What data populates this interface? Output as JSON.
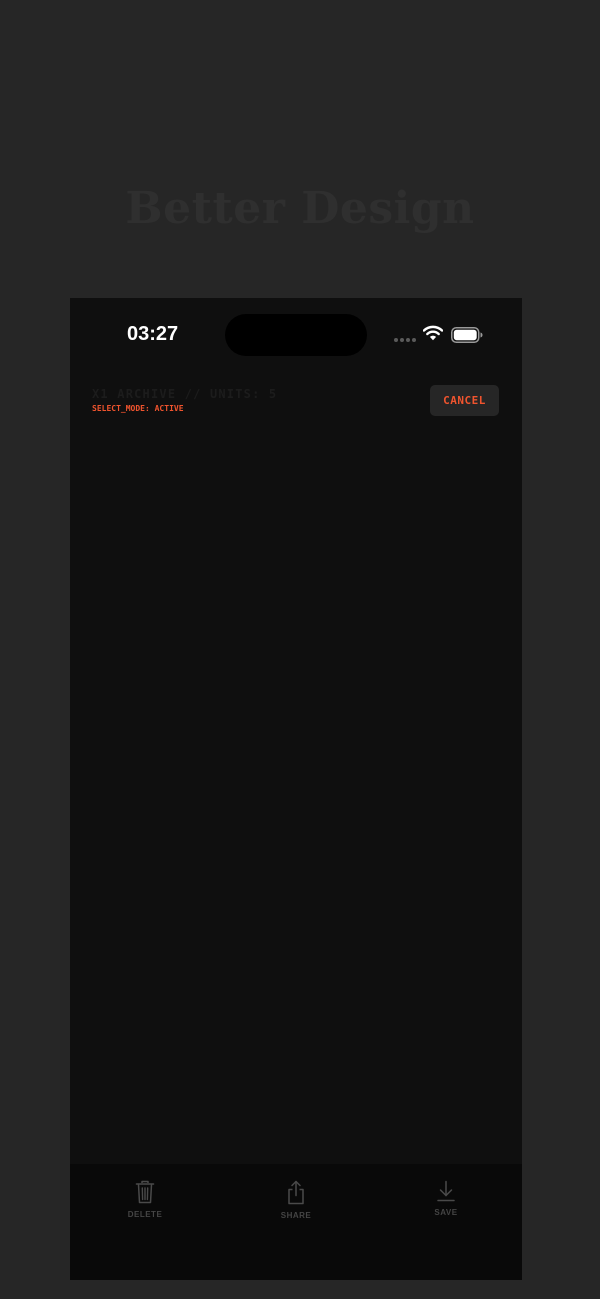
{
  "banner": {
    "title": "Better Design"
  },
  "status_bar": {
    "time": "03:27"
  },
  "header": {
    "title": "X1 ARCHIVE // UNITS: 5",
    "subtitle": "SELECT_MODE: ACTIVE",
    "cancel_label": "CANCEL"
  },
  "toolbar": {
    "delete_label": "DELETE",
    "share_label": "SHARE",
    "save_label": "SAVE"
  },
  "colors": {
    "background": "#262626",
    "screen": "#0f0f0f",
    "accent": "#f0542e",
    "toolbar": "#090909"
  },
  "icons": {
    "delete": "trash-icon",
    "share": "share-icon",
    "save": "download-icon",
    "wifi": "wifi-icon",
    "battery": "battery-icon",
    "signal": "signal-dots-icon"
  }
}
